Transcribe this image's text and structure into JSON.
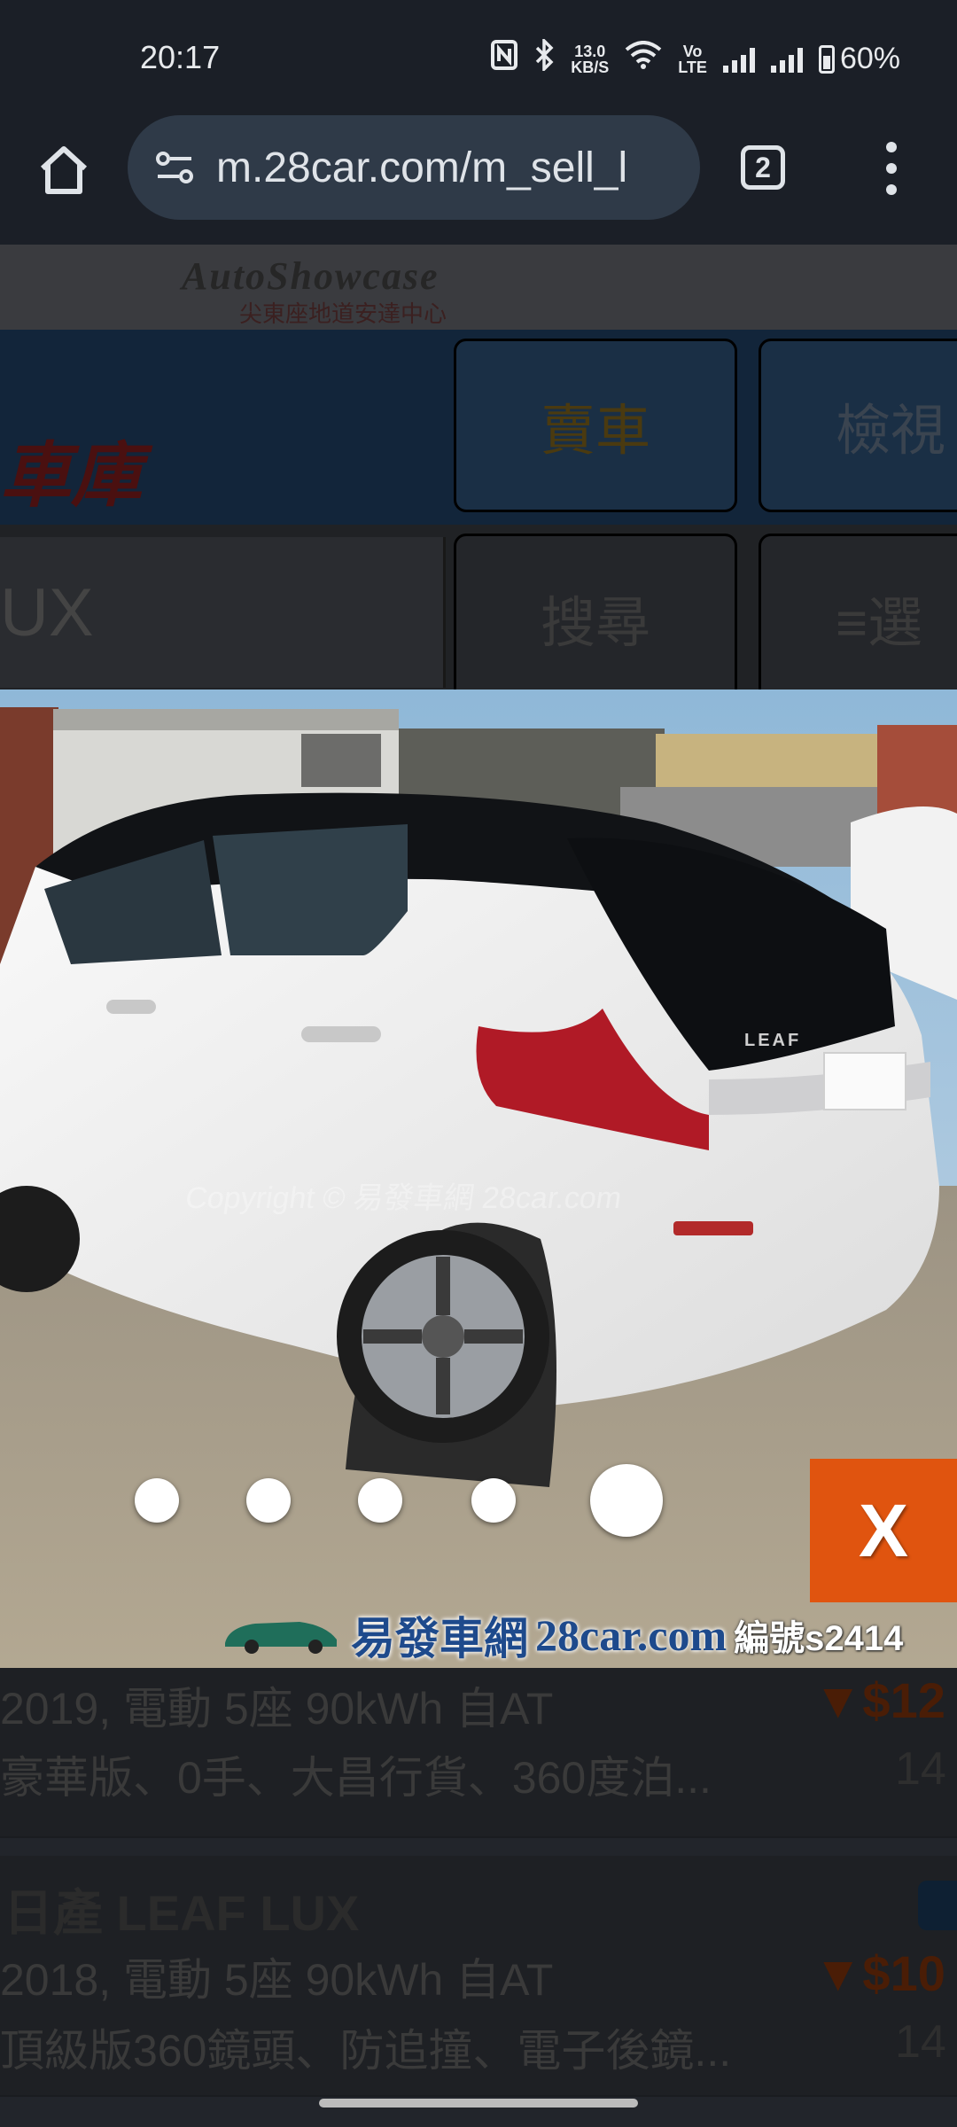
{
  "status_bar": {
    "time": "20:17",
    "net_speed_value": "13.0",
    "net_speed_unit": "KB/S",
    "volte_top": "Vo",
    "volte_bottom": "LTE",
    "battery": "60%"
  },
  "browser": {
    "url": "m.28car.com/m_sell_l",
    "tab_count": "2"
  },
  "background_page": {
    "banner_title": "AutoShowcase",
    "banner_subtitle": "尖東座地道安達中心",
    "brand_fragment": "車庫",
    "nav_buttons": [
      "賣車",
      "檢視"
    ],
    "search_value": "UX",
    "action_buttons": [
      "搜尋",
      "≡選"
    ],
    "listings": [
      {
        "title": "日產 LEAF LUX",
        "spec": "2019, 電動 5座 90kWh 自AT",
        "desc": "豪華版、0手、大昌行貨、360度泊...",
        "price": "▼$12",
        "number": "14"
      },
      {
        "title": "日產 LEAF LUX",
        "spec": "2018, 電動 5座 90kWh 自AT",
        "desc": "頂級版360鏡頭、防追撞、電子後鏡...",
        "price": "▼$10",
        "number": "14"
      }
    ]
  },
  "viewer": {
    "copyright": "Copyright © 易發車網 28car.com",
    "car_badge": "LEAF",
    "footer_cn": "易發車網",
    "footer_site": "28car.com",
    "footer_id": "編號s2414",
    "close_label": "X",
    "active_photo_index": 5,
    "photo_count": 5
  }
}
